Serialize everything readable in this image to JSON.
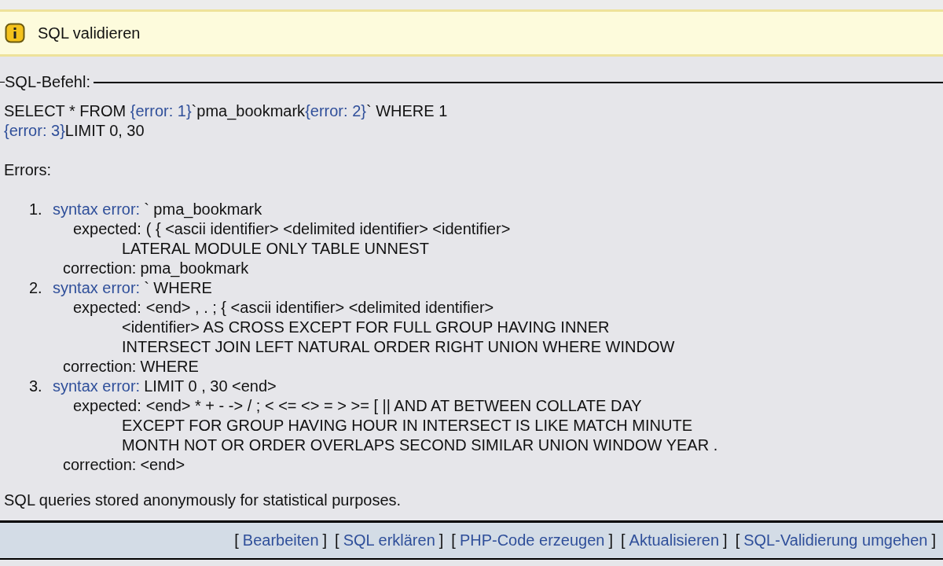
{
  "notice": {
    "title": "SQL validieren"
  },
  "sql_panel": {
    "legend": "SQL-Befehl:",
    "query_lines": [
      [
        {
          "kind": "text",
          "text": "SELECT * FROM "
        },
        {
          "kind": "marker",
          "text": "{error: 1}"
        },
        {
          "kind": "text",
          "text": "`pma_bookmark"
        },
        {
          "kind": "marker",
          "text": "{error: 2}"
        },
        {
          "kind": "text",
          "text": "` WHERE 1"
        }
      ],
      [
        {
          "kind": "marker",
          "text": "{error: 3}"
        },
        {
          "kind": "text",
          "text": "LIMIT 0, 30"
        }
      ]
    ],
    "errors_heading": "Errors:",
    "errors": [
      {
        "number": "1.",
        "label": "syntax error:",
        "token": "` pma_bookmark",
        "expected_label": "expected:",
        "expected": [
          "( { <ascii identifier> <delimited identifier> <identifier>",
          "LATERAL MODULE ONLY TABLE UNNEST"
        ],
        "correction_label": "correction:",
        "correction": "pma_bookmark"
      },
      {
        "number": "2.",
        "label": "syntax error:",
        "token": "` WHERE",
        "expected_label": "expected:",
        "expected": [
          "<end> , . ; { <ascii identifier> <delimited identifier>",
          "<identifier> AS CROSS EXCEPT FOR FULL GROUP HAVING INNER",
          "INTERSECT JOIN LEFT NATURAL ORDER RIGHT UNION WHERE WINDOW"
        ],
        "correction_label": "correction:",
        "correction": "WHERE"
      },
      {
        "number": "3.",
        "label": "syntax error:",
        "token": "LIMIT 0 , 30 <end>",
        "expected_label": "expected:",
        "expected": [
          "<end> * + - -> / ; < <= <> = > >= [ || AND AT BETWEEN COLLATE DAY",
          "EXCEPT FOR GROUP HAVING HOUR IN INTERSECT IS LIKE MATCH MINUTE",
          "MONTH NOT OR ORDER OVERLAPS SECOND SIMILAR UNION WINDOW YEAR ."
        ],
        "correction_label": "correction:",
        "correction": "<end>"
      }
    ],
    "note": "SQL queries stored anonymously for statistical purposes."
  },
  "footer": [
    {
      "kind": "bracket",
      "text": "["
    },
    {
      "kind": "link",
      "text": "Bearbeiten"
    },
    {
      "kind": "bracket",
      "text": "]"
    },
    {
      "kind": "bracket",
      "text": "["
    },
    {
      "kind": "link",
      "text": "SQL erklären"
    },
    {
      "kind": "bracket",
      "text": "]"
    },
    {
      "kind": "bracket",
      "text": "["
    },
    {
      "kind": "link",
      "text": "PHP-Code erzeugen"
    },
    {
      "kind": "bracket",
      "text": "]"
    },
    {
      "kind": "bracket",
      "text": "["
    },
    {
      "kind": "link",
      "text": "Aktualisieren"
    },
    {
      "kind": "bracket",
      "text": "]"
    },
    {
      "kind": "bracket",
      "text": "["
    },
    {
      "kind": "link",
      "text": "SQL-Validierung umgehen"
    },
    {
      "kind": "bracket",
      "text": "]"
    }
  ]
}
